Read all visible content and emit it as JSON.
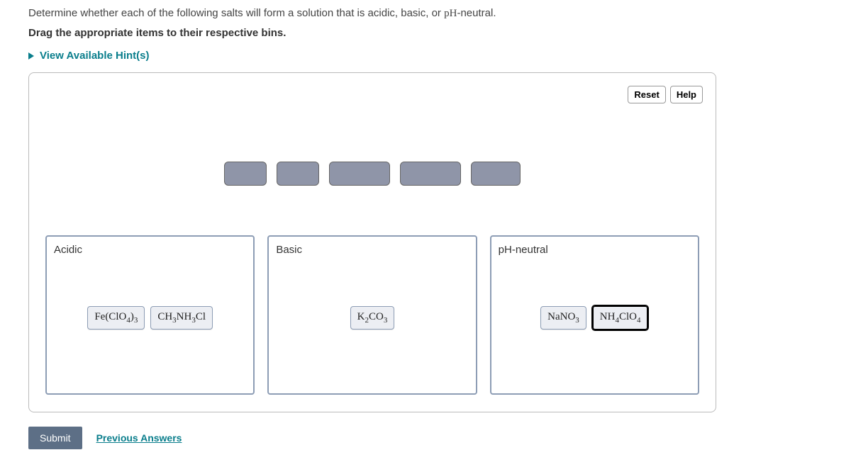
{
  "question": {
    "text_before": "Determine whether each of the following salts will form a solution that is acidic, basic, or ",
    "ph_term": "pH",
    "text_after": "-neutral.",
    "instruction": "Drag the appropriate items to their respective bins."
  },
  "hints": {
    "label": "View Available Hint(s)"
  },
  "controls": {
    "reset": "Reset",
    "help": "Help"
  },
  "bins": {
    "acidic": {
      "label": "Acidic",
      "items": [
        {
          "formula_html": "Fe(ClO<sub>4</sub>)<sub>3</sub>",
          "name": "iron-perchlorate"
        },
        {
          "formula_html": "CH<sub>3</sub>NH<sub>3</sub>Cl",
          "name": "methylammonium-chloride"
        }
      ]
    },
    "basic": {
      "label": "Basic",
      "items": [
        {
          "formula_html": "K<sub>2</sub>CO<sub>3</sub>",
          "name": "potassium-carbonate"
        }
      ]
    },
    "neutral": {
      "label": "pH-neutral",
      "items": [
        {
          "formula_html": "NaNO<sub>3</sub>",
          "name": "sodium-nitrate"
        },
        {
          "formula_html": "NH<sub>4</sub>ClO<sub>4</sub>",
          "name": "ammonium-perchlorate",
          "selected": true
        }
      ]
    }
  },
  "footer": {
    "submit": "Submit",
    "previous": "Previous Answers"
  }
}
